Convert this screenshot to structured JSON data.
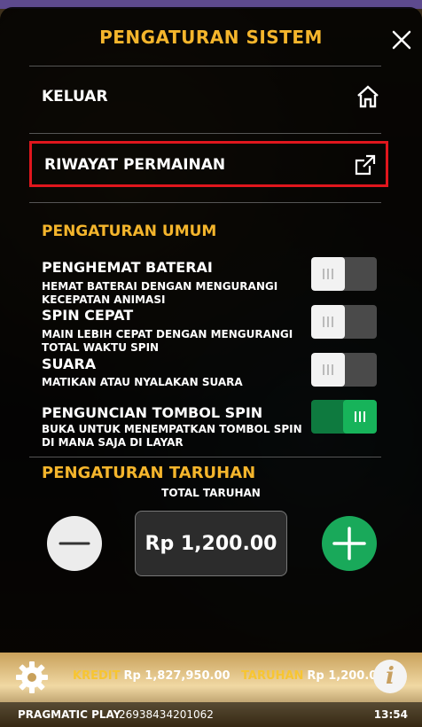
{
  "dialog": {
    "title": "PENGATURAN SISTEM",
    "menu": {
      "exit_label": "KELUAR",
      "history_label": "RIWAYAT PERMAINAN"
    }
  },
  "general": {
    "heading": "PENGATURAN UMUM",
    "settings": [
      {
        "title": "PENGHEMAT BATERAI",
        "desc": "HEMAT BATERAI DENGAN MENGURANGI KECEPATAN ANIMASI",
        "enabled": false
      },
      {
        "title": "SPIN CEPAT",
        "desc": "MAIN LEBIH CEPAT DENGAN MENGURANGI TOTAL WAKTU SPIN",
        "enabled": false
      },
      {
        "title": "SUARA",
        "desc": "MATIKAN ATAU NYALAKAN SUARA",
        "enabled": false
      },
      {
        "title": "PENGUNCIAN TOMBOL SPIN",
        "desc": "BUKA UNTUK MENEMPATKAN TOMBOL SPIN DI MANA SAJA DI LAYAR",
        "enabled": true
      }
    ]
  },
  "bet": {
    "heading": "PENGATURAN TARUHAN",
    "total_label": "TOTAL TARUHAN",
    "value": "Rp 1,200.00"
  },
  "status_bar": {
    "credit_label": "KREDIT",
    "credit_value": "Rp 1,827,950.00",
    "bet_label": "TARUHAN",
    "bet_value": "Rp 1,200.00",
    "brand": "PRAGMATIC PLAY",
    "round_id": "26938434201062",
    "time": "13:54",
    "info_glyph": "i"
  },
  "colors": {
    "accent": "#f4b52c",
    "toggle_on": "#17b35a",
    "highlight": "#e0161d"
  },
  "icons": [
    "close-icon",
    "home-icon",
    "external-link-icon",
    "minus-icon",
    "plus-icon",
    "gear-icon",
    "info-icon"
  ]
}
